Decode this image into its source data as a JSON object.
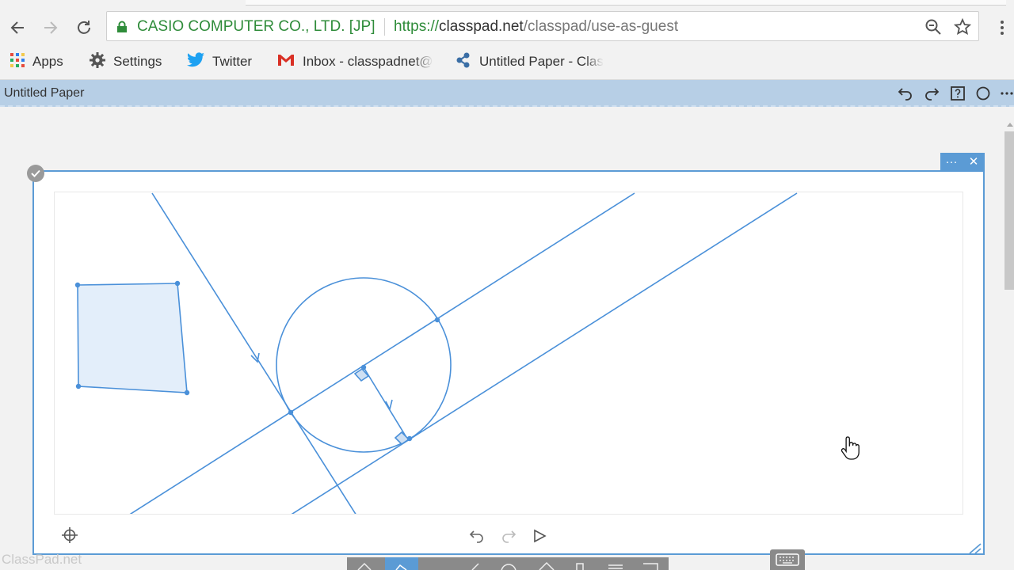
{
  "browser": {
    "site_identity": "CASIO COMPUTER CO., LTD. [JP]",
    "url_scheme": "https://",
    "url_host": "classpad.net",
    "url_path": "/classpad/use-as-guest"
  },
  "bookmarks": [
    {
      "label": "Apps",
      "icon": "apps-grid-icon"
    },
    {
      "label": "Settings",
      "icon": "gear-icon"
    },
    {
      "label": "Twitter",
      "icon": "twitter-bird-icon"
    },
    {
      "label": "Inbox - classpadnet@",
      "icon": "gmail-icon"
    },
    {
      "label": "Untitled Paper - Clas",
      "icon": "classpad-icon"
    }
  ],
  "app": {
    "paper_title": "Untitled Paper",
    "watermark": "ClassPad.net",
    "card_menu_label": "···",
    "card_close_label": "✕",
    "accent_color": "#5b9bd5"
  },
  "icons": {
    "header": [
      "undo-icon",
      "redo-icon",
      "help-icon",
      "circle-icon",
      "more-icon"
    ],
    "card_bottom": [
      "crosshair-icon",
      "undo-icon",
      "redo-icon",
      "play-icon"
    ]
  }
}
